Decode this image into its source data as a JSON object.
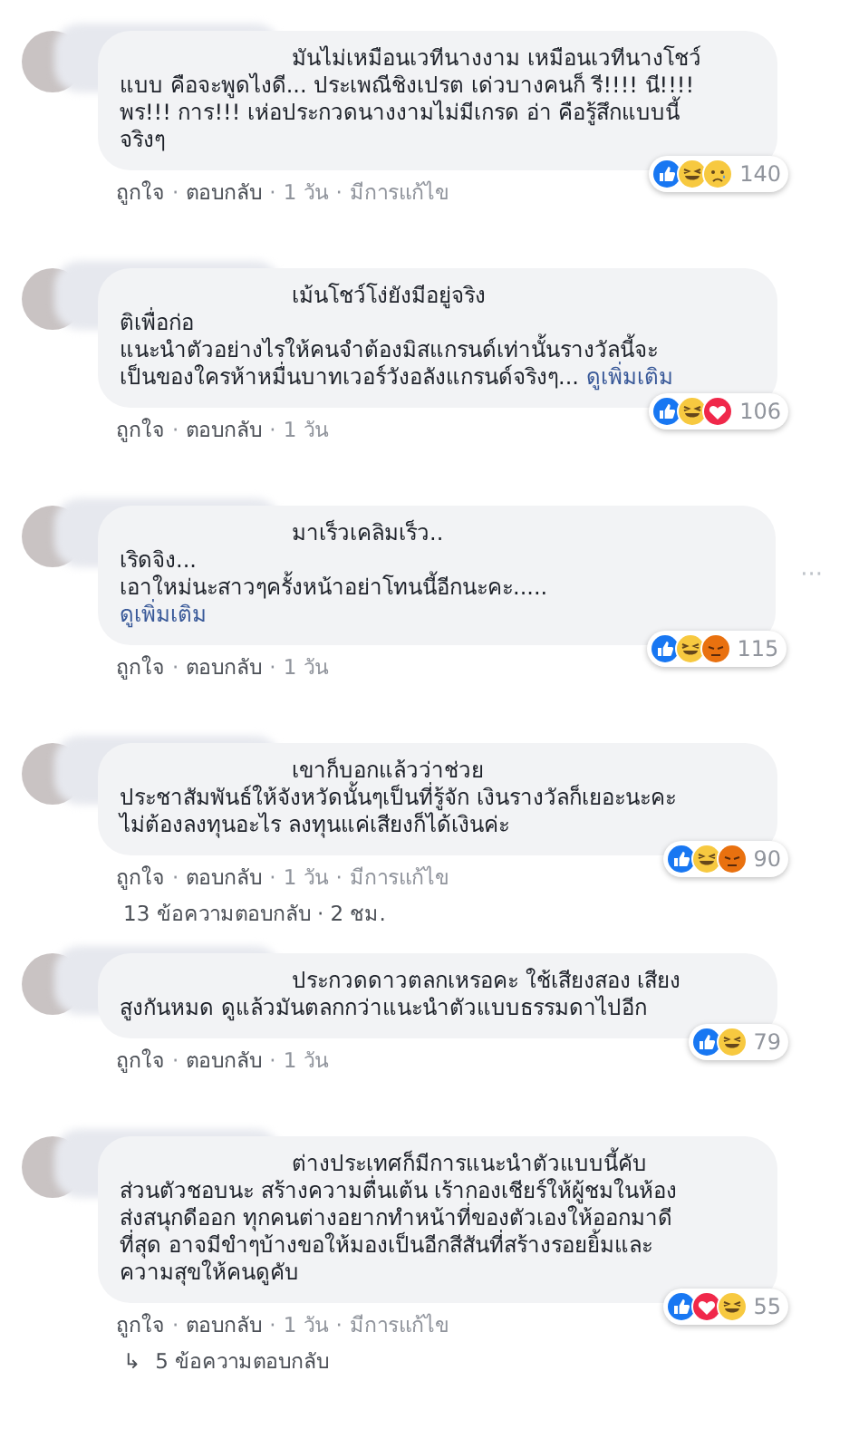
{
  "separator": "·",
  "comments": [
    {
      "lines": [
        "มันไม่เหมือนเวทีนางงาม เหมือนเวทีนางโชว์",
        "แบบ คือจะพูดไงดี... ประเพณีชิงเปรต เด่วบางคนก็ รี!!!! นี!!!!",
        "พร!!! การ!!! เห่อประกวดนางงามไม่มีเกรด อ่า คือรู้สึกแบบนี้",
        "จริงๆ"
      ],
      "reactions": [
        {
          "kind": "like"
        },
        {
          "kind": "haha"
        },
        {
          "kind": "sad"
        }
      ],
      "count": "140",
      "actions": [
        "ถูกใจ",
        "ตอบกลับ"
      ],
      "time": "1 วัน",
      "edited": "มีการแก้ไข"
    },
    {
      "lines": [
        "เม้นโชว์โง่ยังมีอยู่จริง",
        "ติเพื่อก่อ",
        "แนะนำตัวอย่างไรให้คนจำต้องมิสแกรนด์เท่านั้นรางวัลนี้จะ",
        "เป็นของใครห้าหมื่นบาทเวอร์วังอลังแกรนด์จริงๆ..."
      ],
      "inline_more": "ดูเพิ่มเติม",
      "reactions": [
        {
          "kind": "like"
        },
        {
          "kind": "haha"
        },
        {
          "kind": "love"
        }
      ],
      "count": "106",
      "actions": [
        "ถูกใจ",
        "ตอบกลับ"
      ],
      "time": "1 วัน"
    },
    {
      "lines": [
        "มาเร็วเคลิมเร็ว..",
        "เริดจิง...",
        "เอาใหม่นะสาวๆครั้งหน้าอย่าโทนนี้อีกนะคะ....."
      ],
      "block_more": "ดูเพิ่มเติม",
      "options": "···",
      "reactions": [
        {
          "kind": "like"
        },
        {
          "kind": "haha"
        },
        {
          "kind": "angry"
        }
      ],
      "count": "115",
      "actions": [
        "ถูกใจ",
        "ตอบกลับ"
      ],
      "time": "1 วัน"
    },
    {
      "lines": [
        "เขาก็บอกแล้วว่าช่วย",
        "ประชาสัมพันธ์ให้จังหวัดนั้นๆเป็นที่รู้จัก เงินรางวัลก็เยอะนะคะ",
        "ไม่ต้องลงทุนอะไร ลงทุนแค่เสียงก็ได้เงินค่ะ"
      ],
      "reactions": [
        {
          "kind": "like"
        },
        {
          "kind": "haha"
        },
        {
          "kind": "angry"
        }
      ],
      "count": "90",
      "actions": [
        "ถูกใจ",
        "ตอบกลับ"
      ],
      "time": "1 วัน",
      "edited": "มีการแก้ไข",
      "replies": "13 ข้อความตอบกลับ · 2 ชม."
    },
    {
      "lines": [
        "ประกวดดาวตลกเหรอคะ ใช้เสียงสอง เสียง",
        "สูงกันหมด ดูแล้วมันตลกกว่าแนะนำตัวแบบธรรมดาไปอีก"
      ],
      "reactions": [
        {
          "kind": "like"
        },
        {
          "kind": "haha"
        }
      ],
      "count": "79",
      "actions": [
        "ถูกใจ",
        "ตอบกลับ"
      ],
      "time": "1 วัน"
    },
    {
      "lines": [
        "ต่างประเทศก็มีการแนะนำตัวแบบนี้คับ",
        "ส่วนตัวชอบนะ สร้างความตื่นเต้น เร้ากองเชียร์ให้ผู้ชมในห้อง",
        "ส่งสนุกดีออก ทุกคนต่างอยากทำหน้าที่ของตัวเองให้ออกมาดี",
        "ที่สุด อาจมีขำๆบ้างขอให้มองเป็นอีกสีสันที่สร้างรอยยิ้มและ",
        "ความสุขให้คนดูคับ"
      ],
      "reactions": [
        {
          "kind": "like"
        },
        {
          "kind": "love"
        },
        {
          "kind": "haha"
        }
      ],
      "count": "55",
      "actions": [
        "ถูกใจ",
        "ตอบกลับ"
      ],
      "time": "1 วัน",
      "edited": "มีการแก้ไข",
      "replies": "5 ข้อความตอบกลับ",
      "reply_arrow": "↳"
    }
  ]
}
